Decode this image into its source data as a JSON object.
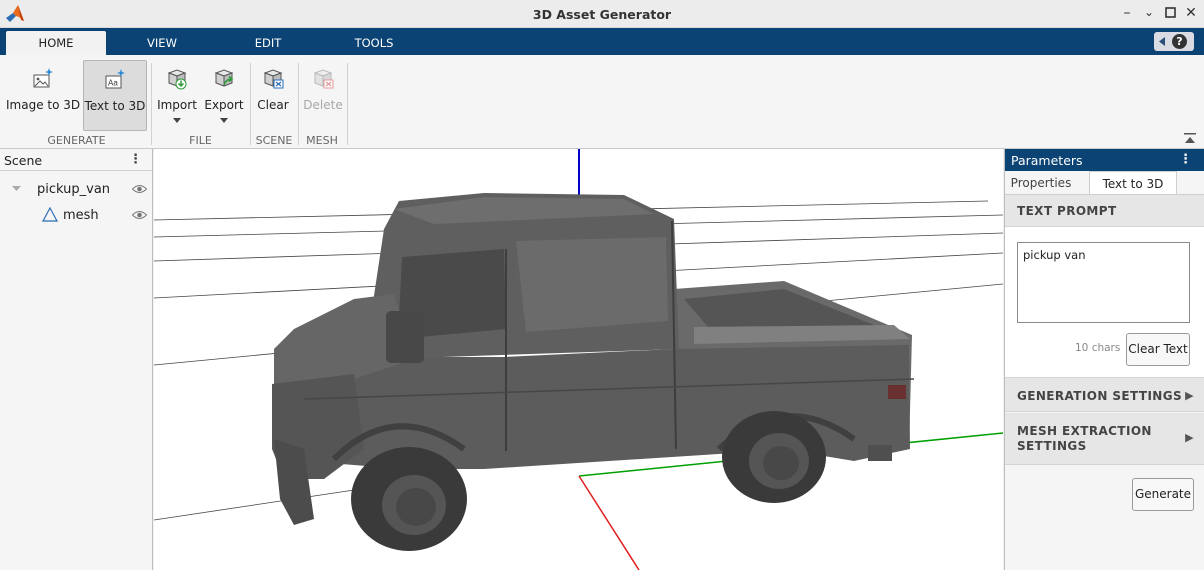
{
  "window": {
    "title": "3D Asset Generator"
  },
  "tabs": [
    {
      "label": "HOME",
      "active": true
    },
    {
      "label": "VIEW",
      "active": false
    },
    {
      "label": "EDIT",
      "active": false
    },
    {
      "label": "TOOLS",
      "active": false
    }
  ],
  "ribbon": {
    "buttons": {
      "image_to_3d": "Image to 3D",
      "text_to_3d": "Text to 3D",
      "import": "Import",
      "export": "Export",
      "clear": "Clear",
      "delete": "Delete"
    },
    "groups": {
      "generate": "GENERATE",
      "file": "FILE",
      "scene": "SCENE",
      "mesh": "MESH"
    }
  },
  "scene_panel": {
    "title": "Scene",
    "items": [
      {
        "label": "pickup_van",
        "icon": "chevron-down-icon",
        "visible": true
      },
      {
        "label": "mesh",
        "icon": "mesh-triangle-icon",
        "visible": true
      }
    ]
  },
  "params_panel": {
    "title": "Parameters",
    "tabs": [
      {
        "label": "Properties",
        "active": false
      },
      {
        "label": "Text to 3D",
        "active": true
      }
    ],
    "text_prompt": {
      "heading": "TEXT PROMPT",
      "value": "pickup van",
      "char_count": "10 chars",
      "clear_label": "Clear Text"
    },
    "generation_settings": "GENERATION SETTINGS",
    "mesh_extraction_settings_line1": "MESH EXTRACTION",
    "mesh_extraction_settings_line2": "SETTINGS",
    "generate_label": "Generate"
  },
  "colors": {
    "tab_bar": "#0a4374",
    "axis_z": "#0000c8",
    "axis_x": "#e02020",
    "axis_y": "#00a000",
    "model_gray": "#5a5a5a"
  }
}
